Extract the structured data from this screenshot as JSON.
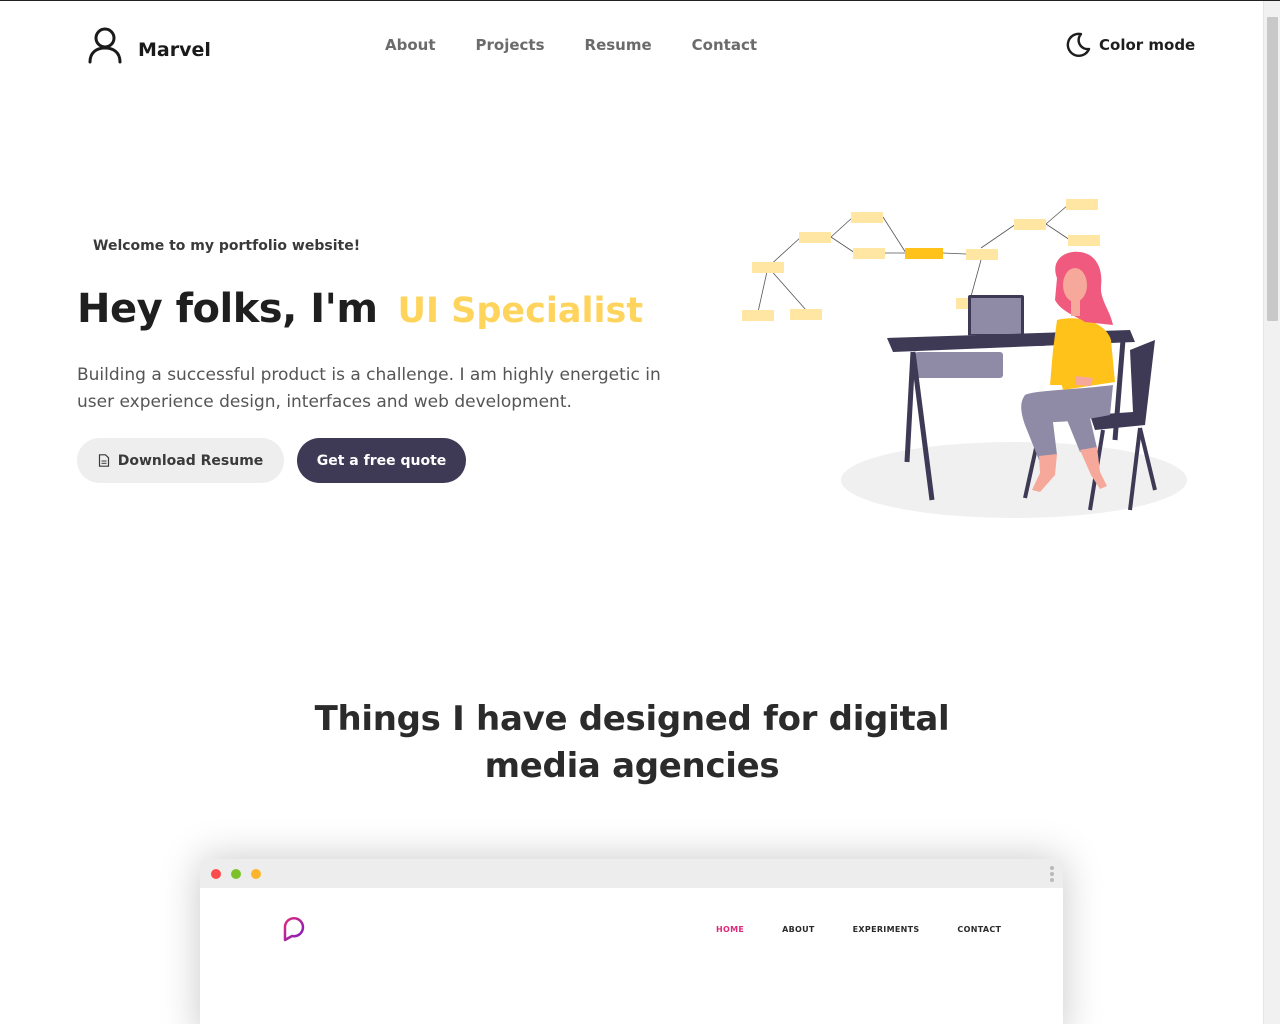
{
  "brand": {
    "name": "Marvel",
    "icon": "user-outline-icon"
  },
  "nav": {
    "items": [
      {
        "label": "About"
      },
      {
        "label": "Projects"
      },
      {
        "label": "Resume"
      },
      {
        "label": "Contact"
      }
    ]
  },
  "color_mode": {
    "label": "Color mode",
    "icon": "moon-icon"
  },
  "hero": {
    "welcome": "Welcome to my portfolio website!",
    "title": "Hey folks, I'm",
    "role": "UI Specialist",
    "description": "Building a successful product is a challenge. I am highly energetic in user experience design, interfaces and web development.",
    "buttons": {
      "download": "Download Resume",
      "quote": "Get a free quote"
    },
    "illustration": "woman-at-desk-with-laptop-illustration"
  },
  "projects": {
    "title": "Things I have designed for digital media agencies"
  },
  "mockup": {
    "nav": [
      {
        "label": "HOME",
        "active": true
      },
      {
        "label": "ABOUT",
        "active": false
      },
      {
        "label": "EXPERIMENTS",
        "active": false
      },
      {
        "label": "CONTACT",
        "active": false
      }
    ]
  },
  "colors": {
    "accent_yellow": "#ffd45c",
    "primary_dark": "#3e3a55",
    "mockup_active": "#e0297b"
  }
}
